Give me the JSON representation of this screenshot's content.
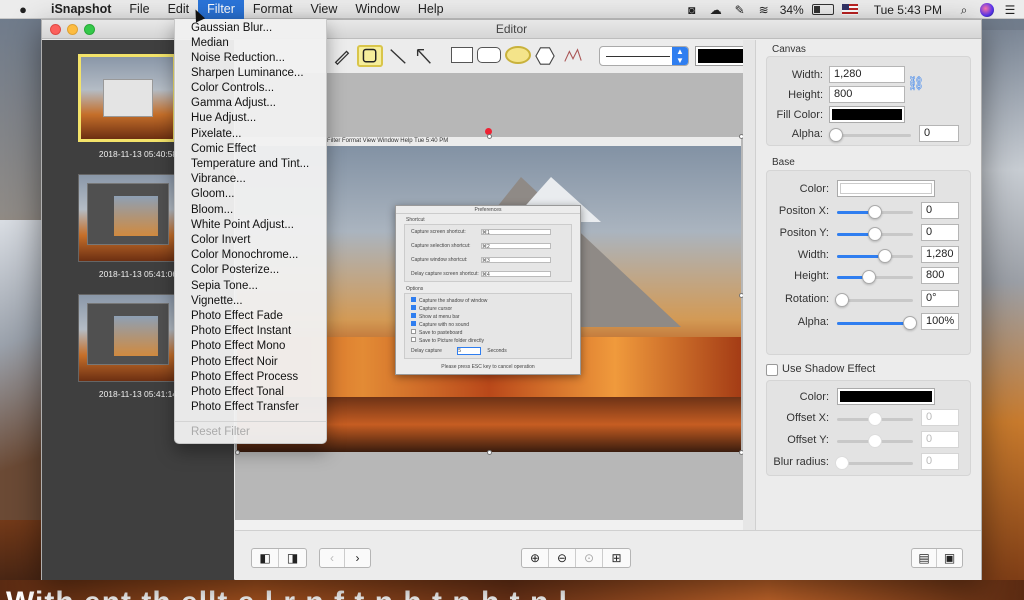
{
  "menubar": {
    "apple_icon": "apple-logo-icon",
    "app_name": "iSnapshot",
    "items": [
      "File",
      "Edit",
      "Filter",
      "Format",
      "View",
      "Window",
      "Help"
    ],
    "active_item": "Filter",
    "battery_percent": "34%",
    "clock": "Tue 5:43 PM"
  },
  "window": {
    "title": "Editor"
  },
  "sidebar": {
    "thumbnails": [
      {
        "label": "2018-11-13 05:40:58"
      },
      {
        "label": "2018-11-13 05:41:06"
      },
      {
        "label": "2018-11-13 05:41:14"
      }
    ]
  },
  "canvas": {
    "screenshot_menubar": "Filter   Format   View   Window   Help                                                    Tue 5:40 PM",
    "prefs": {
      "title": "Preferences",
      "shortcut_heading": "Shortcut",
      "shortcuts": [
        {
          "label": "Capture screen shortcut:",
          "key": "⌘1"
        },
        {
          "label": "Capture selection shortcut:",
          "key": "⌘2"
        },
        {
          "label": "Capture window shortcut:",
          "key": "⌘3"
        },
        {
          "label": "Delay capture screen shortcut:",
          "key": "⌘4"
        }
      ],
      "options_heading": "Options",
      "options": [
        "Capture the shadow of window",
        "Capture cursor",
        "Show at menu bar",
        "Capture with no sound",
        "Save to pasteboard",
        "Save to Picture folder directly"
      ],
      "delay_label": "Delay capture",
      "delay_value": "5",
      "delay_unit": "Seconds",
      "footer": "Please press ESC key to cancel operation"
    }
  },
  "inspector": {
    "canvas_title": "Canvas",
    "width_label": "Width:",
    "width_value": "1,280",
    "height_label": "Height:",
    "height_value": "800",
    "fill_label": "Fill Color:",
    "alpha_label": "Alpha:",
    "alpha_value": "0",
    "base_title": "Base",
    "color_label": "Color:",
    "posx_label": "Positon X:",
    "posx_value": "0",
    "posy_label": "Positon Y:",
    "posy_value": "0",
    "bwidth_label": "Width:",
    "bwidth_value": "1,280",
    "bheight_label": "Height:",
    "bheight_value": "800",
    "rotation_label": "Rotation:",
    "rotation_value": "0°",
    "balpha_label": "Alpha:",
    "balpha_value": "100%",
    "shadow_label": "Use Shadow Effect",
    "s_color_label": "Color:",
    "offx_label": "Offset X:",
    "offx_value": "0",
    "offy_label": "Offset Y:",
    "offy_value": "0",
    "blur_label": "Blur radius:",
    "blur_value": "0"
  },
  "filter_menu": {
    "items": [
      "Gaussian Blur...",
      "Median",
      "Noise Reduction...",
      "Sharpen Luminance...",
      "Color Controls...",
      "Gamma Adjust...",
      "Hue Adjust...",
      "Pixelate...",
      "Comic Effect",
      "Temperature and Tint...",
      "Vibrance...",
      "Gloom...",
      "Bloom...",
      "White Point Adjust...",
      "Color Invert",
      "Color Monochrome...",
      "Color Posterize...",
      "Sepia Tone...",
      "Vignette...",
      "Photo Effect Fade",
      "Photo Effect Instant",
      "Photo Effect Mono",
      "Photo Effect Noir",
      "Photo Effect Process",
      "Photo Effect Tonal",
      "Photo Effect Transfer"
    ],
    "reset": "Reset Filter"
  },
  "desktop_caption": "With     ent th      ellt        e     l      r    n  f      t       n   h     t       n   h    t      n   l",
  "colors": {
    "accent": "#2f7ef0",
    "menu_highlight": "#2a74d9",
    "active_tool": "#f6ee9b",
    "thumb_selected_border": "#f3e36a"
  }
}
